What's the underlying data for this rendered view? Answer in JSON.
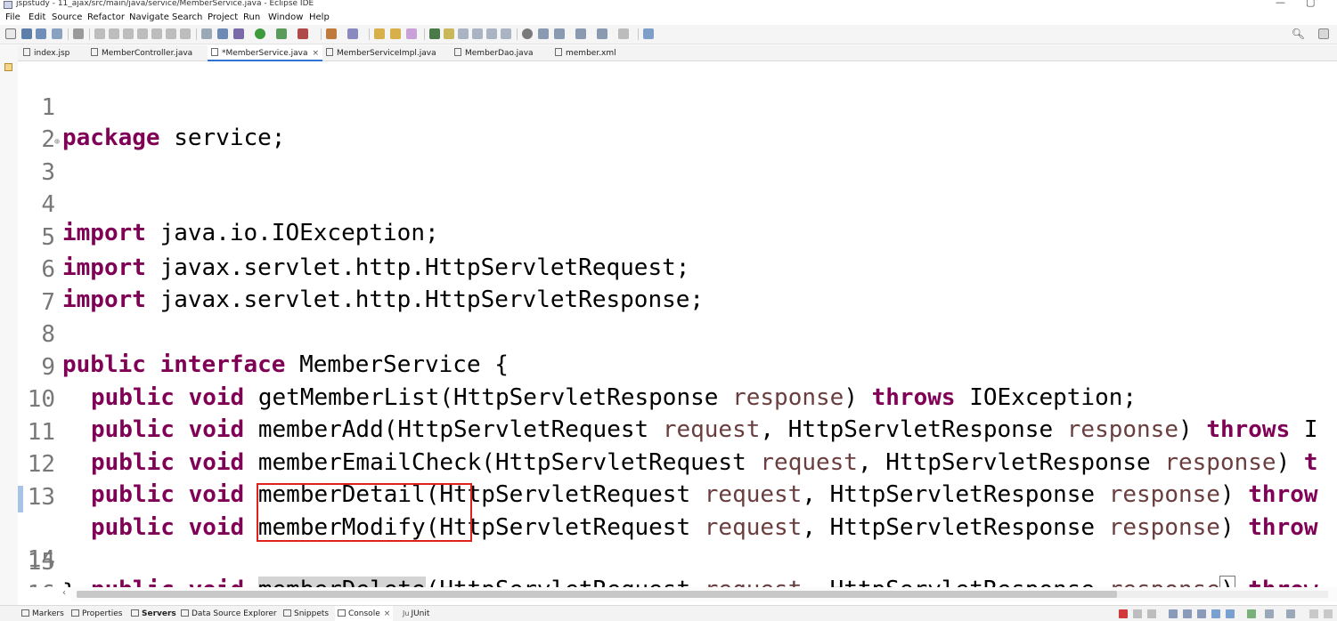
{
  "window": {
    "title": "jspstudy - 11_ajax/src/main/java/service/MemberService.java - Eclipse IDE",
    "minimize_glyph": "—",
    "maximize_glyph": "▢"
  },
  "menu": {
    "items": [
      "File",
      "Edit",
      "Source",
      "Refactor",
      "Navigate",
      "Search",
      "Project",
      "Run",
      "Window",
      "Help"
    ]
  },
  "editor_tabs": [
    {
      "label": "index.jsp",
      "icon": "jsp-file-icon",
      "active": false
    },
    {
      "label": "MemberController.java",
      "icon": "java-file-icon",
      "active": false
    },
    {
      "label": "*MemberService.java",
      "icon": "java-file-icon",
      "active": true,
      "close": "×"
    },
    {
      "label": "MemberServiceImpl.java",
      "icon": "java-file-icon",
      "active": false
    },
    {
      "label": "MemberDao.java",
      "icon": "java-file-icon",
      "active": false
    },
    {
      "label": "member.xml",
      "icon": "xml-file-icon",
      "active": false
    }
  ],
  "code": {
    "lines": {
      "n1": "1",
      "n2": "2",
      "n3": "3",
      "n4": "4",
      "n5": "5",
      "n6": "6",
      "n7": "7",
      "n8": "8",
      "n9": "9",
      "n10": "10",
      "n11": "11",
      "n12": "12",
      "n13": "13",
      "n14": "14",
      "n15": "15",
      "n16": "16"
    },
    "kw": {
      "package": "package",
      "import": "import",
      "public": "public",
      "interface": "interface",
      "void": "void",
      "throws": "throws",
      "throw": "throw",
      "t": "t"
    },
    "text": {
      "l1": " service;",
      "l3": " java.io.IOException;",
      "l5": " javax.servlet.http.HttpServletRequest;",
      "l6": " javax.servlet.http.HttpServletResponse;",
      "l8": " MemberService {",
      "l9_a": " getMemberList(HttpServletResponse ",
      "l9_b": ") ",
      "l9_c": " IOException;",
      "l10_a": " memberAdd(HttpServletRequest ",
      "l10_b": ", HttpServletResponse ",
      "l10_c": ") ",
      "l10_d": " I",
      "l11_a": " memberEmailCheck(HttpServletRequest ",
      "l11_b": ", HttpServletResponse ",
      "l11_c": ") ",
      "l12_a": " memberDetail(HttpServletRequest ",
      "l12_b": ", HttpServletResponse ",
      "l12_c": ") ",
      "l13_a": " memberModify(HttpServletRequest ",
      "l13_b": ", HttpServletResponse ",
      "l13_c": ") ",
      "l14_sel": "memberDelete",
      "l14_a": "(HttpServletRequest ",
      "l14_b": ", HttpServletResponse ",
      "l14_close": ")",
      "l14_c": " ",
      "l15": "}",
      "space": " "
    },
    "params": {
      "request": "request",
      "response": "response"
    }
  },
  "bottom_tabs": [
    {
      "label": "Markers",
      "icon": "markers-icon"
    },
    {
      "label": "Properties",
      "icon": "properties-icon"
    },
    {
      "label": "Servers",
      "icon": "servers-icon",
      "bold": true
    },
    {
      "label": "Data Source Explorer",
      "icon": "data-source-icon"
    },
    {
      "label": "Snippets",
      "icon": "snippets-icon"
    },
    {
      "label": "Console",
      "icon": "console-icon",
      "active": true,
      "close": "×"
    },
    {
      "label": "JUnit",
      "icon": "junit-icon",
      "prefix": "Ju"
    }
  ],
  "colors": {
    "keyword": "#7f0055",
    "parameter": "#6a3e3e",
    "line_number": "#787878",
    "highlight_box": "#e02020"
  }
}
